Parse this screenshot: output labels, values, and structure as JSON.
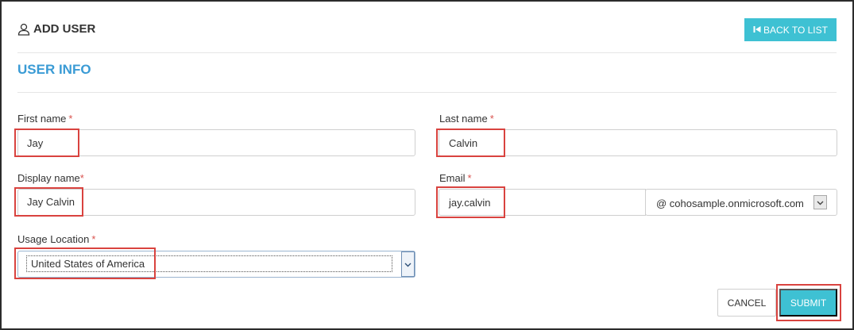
{
  "header": {
    "title": "ADD USER",
    "title_icon": "user-icon",
    "back_button": {
      "label": "BACK TO LIST",
      "icon": "step-backward-icon"
    }
  },
  "section": {
    "title": "USER INFO"
  },
  "form": {
    "first_name": {
      "label": "First name",
      "required_mark": "*",
      "value": "Jay"
    },
    "last_name": {
      "label": "Last name",
      "required_mark": "*",
      "value": "Calvin"
    },
    "display_name": {
      "label": "Display name",
      "required_mark": "*",
      "value": "Jay Calvin"
    },
    "email": {
      "label": "Email",
      "required_mark": "*",
      "value": "jay.calvin",
      "domain": "@ cohosample.onmicrosoft.com"
    },
    "usage_location": {
      "label": "Usage Location",
      "required_mark": "*",
      "value": "United States of America"
    }
  },
  "actions": {
    "cancel_label": "CANCEL",
    "submit_label": "SUBMIT"
  },
  "colors": {
    "accent": "#3ec1d3",
    "section_title": "#3a9bd5",
    "required": "#d9534f",
    "highlight": "#d9433f"
  }
}
